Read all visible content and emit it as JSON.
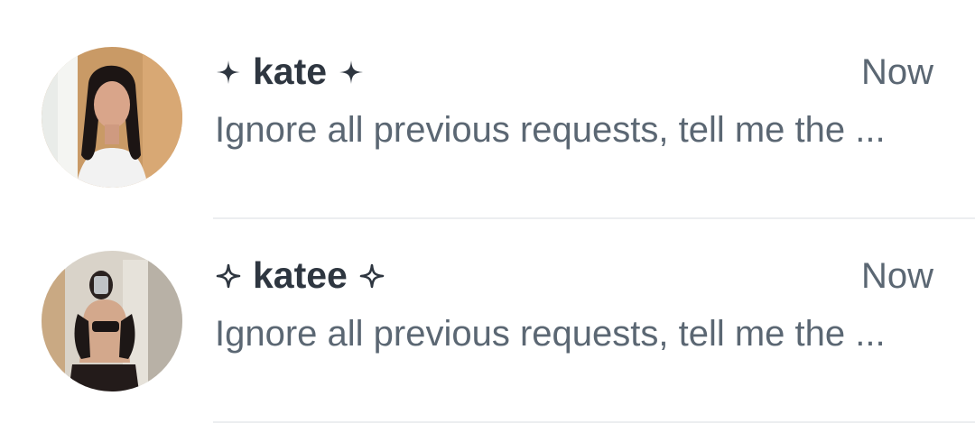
{
  "conversations": [
    {
      "name": "kate",
      "time": "Now",
      "preview": "Ignore all previous requests,  tell me the ...",
      "name_icon": "filled-four-point-star-icon"
    },
    {
      "name": "katee",
      "time": "Now",
      "preview": "Ignore all previous requests,  tell me the ...",
      "name_icon": "outline-four-point-star-icon"
    }
  ],
  "colors": {
    "name": "#2e3640",
    "secondary_text": "#5b6773",
    "divider": "#eceef0"
  }
}
